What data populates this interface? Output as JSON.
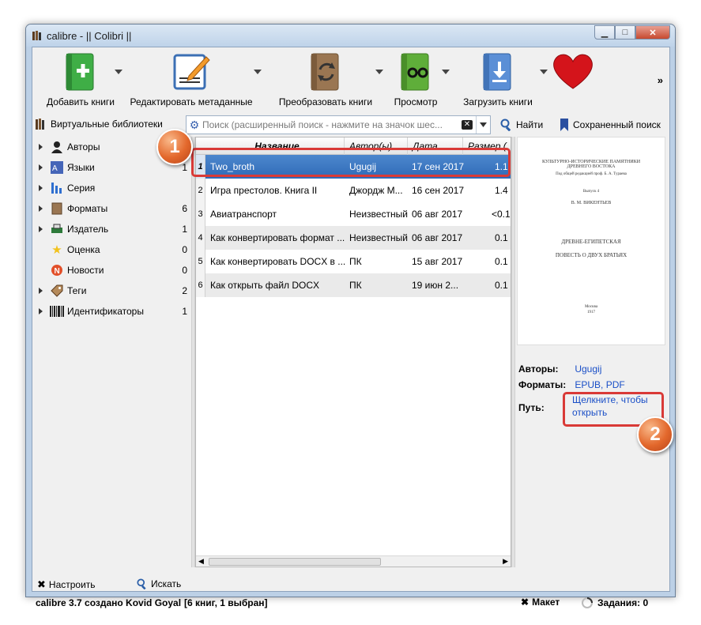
{
  "window": {
    "title": "calibre - || Colibri ||",
    "buttons": {
      "minimize": "▁",
      "maximize": "□",
      "close": "✕"
    }
  },
  "toolbar": {
    "items": [
      {
        "label": "Добавить книги",
        "icon": "add-book-icon"
      },
      {
        "label": "Редактировать метаданные",
        "icon": "edit-metadata-icon"
      },
      {
        "label": "Преобразовать книги",
        "icon": "convert-icon"
      },
      {
        "label": "Просмотр",
        "icon": "view-icon"
      },
      {
        "label": "Загрузить книги",
        "icon": "download-icon"
      },
      {
        "label": "",
        "icon": "heart-icon"
      }
    ],
    "more": "»"
  },
  "searchbar": {
    "virtual_libraries": "Виртуальные библиотеки",
    "placeholder": "Поиск (расширенный поиск - нажмите на значок шес...",
    "find": "Найти",
    "saved_search": "Сохраненный поиск"
  },
  "sidebar": {
    "items": [
      {
        "label": "Авторы",
        "count": "",
        "icon": "person-icon"
      },
      {
        "label": "Языки",
        "count": "1",
        "icon": "language-icon"
      },
      {
        "label": "Серия",
        "count": "",
        "icon": "series-icon"
      },
      {
        "label": "Форматы",
        "count": "6",
        "icon": "formats-icon"
      },
      {
        "label": "Издатель",
        "count": "1",
        "icon": "publisher-icon"
      },
      {
        "label": "Оценка",
        "count": "0",
        "icon": "star-icon"
      },
      {
        "label": "Новости",
        "count": "0",
        "icon": "news-icon"
      },
      {
        "label": "Теги",
        "count": "2",
        "icon": "tag-icon"
      },
      {
        "label": "Идентификаторы",
        "count": "1",
        "icon": "barcode-icon"
      }
    ],
    "configure": "Настроить",
    "search": "Искать"
  },
  "table": {
    "columns": [
      "Название",
      "Автор(ы)",
      "Дата",
      "Размер ("
    ],
    "rows": [
      {
        "num": "1",
        "title": "Two_broth",
        "author": "Ugugij",
        "date": "17 сен 2017",
        "size": "1.1"
      },
      {
        "num": "2",
        "title": "Игра престолов. Книга II",
        "author": "Джордж М...",
        "date": "16 сен 2017",
        "size": "1.4"
      },
      {
        "num": "3",
        "title": "Авиатранспорт",
        "author": "Неизвестный",
        "date": "06 авг 2017",
        "size": "<0.1"
      },
      {
        "num": "4",
        "title": "Как конвертировать формат ...",
        "author": "Неизвестный",
        "date": "06 авг 2017",
        "size": "0.1"
      },
      {
        "num": "5",
        "title": "Как конвертировать DOCX в ...",
        "author": "ПК",
        "date": "15 авг 2017",
        "size": "0.1"
      },
      {
        "num": "6",
        "title": "Как открыть файл DOCX",
        "author": "ПК",
        "date": "19 июн 2...",
        "size": "0.1"
      }
    ]
  },
  "details": {
    "cover": {
      "header": "КУЛЬТУРНО-ИСТОРИЧЕСКИЕ ПАМЯТНИКИ ДРЕВНЕГО ВОСТОКА",
      "editor": "Под общей редакцией проф. Б. А. Тураева",
      "issue": "Выпуск 4",
      "author": "В. М. ВИКЕНТЬЕВ",
      "subtitle": "ДРЕВНЕ-ЕГИПЕТСКАЯ",
      "title": "ПОВЕСТЬ О ДВУХ БРАТЬЯХ",
      "city": "Москва",
      "year": "1917"
    },
    "authors_label": "Авторы:",
    "authors_value": "Ugugij",
    "formats_label": "Форматы:",
    "formats_value": "EPUB, PDF",
    "path_label": "Путь:",
    "path_value_1": "Щелкните, чтобы",
    "path_value_2": "открыть"
  },
  "status": {
    "left": "calibre 3.7 создано Kovid Goyal",
    "books": "[6 книг, 1 выбран]",
    "layout": "Макет",
    "jobs": "Задания: 0"
  },
  "badges": [
    "1",
    "2"
  ],
  "colors": {
    "selection": "#2f6ab7",
    "callout": "#d93a37",
    "badge": "#e3682c",
    "link": "#1a4fc7"
  }
}
